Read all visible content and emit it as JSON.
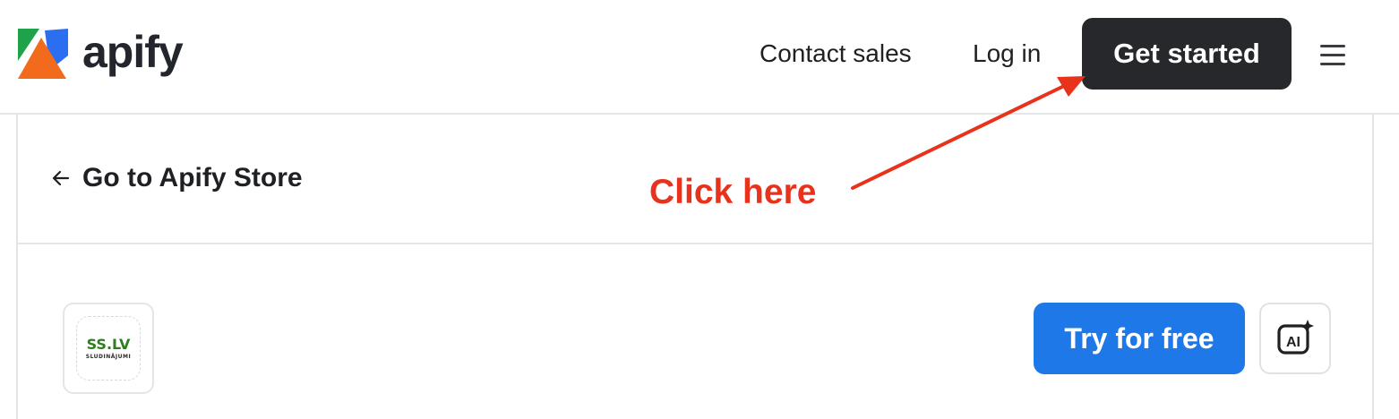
{
  "header": {
    "brand": "apify",
    "links": {
      "contact": "Contact sales",
      "login": "Log in"
    },
    "cta": "Get started"
  },
  "back": {
    "label": "Go to Apify Store"
  },
  "actor": {
    "logo_title": "SS.LV",
    "logo_sub": "SLUDINĀJUMI"
  },
  "actions": {
    "try_label": "Try for free",
    "ai_label": "AI"
  },
  "annotation": {
    "text": "Click here"
  },
  "colors": {
    "cta_bg": "#26282c",
    "try_bg": "#1f78e8",
    "annotation": "#e8321c",
    "logo_green": "#2e7d1e"
  }
}
